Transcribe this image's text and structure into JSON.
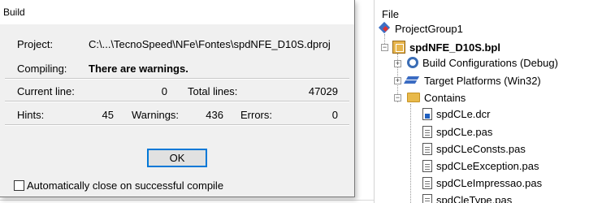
{
  "dialog": {
    "title": "Build",
    "project_label": "Project:",
    "project_value": "C:\\...\\TecnoSpeed\\NFe\\Fontes\\spdNFE_D10S.dproj",
    "compiling_label": "Compiling:",
    "compiling_value": "There are warnings.",
    "current_line_label": "Current line:",
    "current_line_value": "0",
    "total_lines_label": "Total lines:",
    "total_lines_value": "47029",
    "hints_label": "Hints:",
    "hints_value": "45",
    "warnings_label": "Warnings:",
    "warnings_value": "436",
    "errors_label": "Errors:",
    "errors_value": "0",
    "ok_label": "OK",
    "auto_close_label": "Automatically close on successful compile",
    "auto_close_checked": false
  },
  "project_manager": {
    "file_label": "File",
    "group": "ProjectGroup1",
    "project": "spdNFE_D10S.bpl",
    "build_configurations": "Build Configurations (Debug)",
    "target_platforms": "Target Platforms (Win32)",
    "contains": "Contains",
    "files": [
      "spdCLe.dcr",
      "spdCLe.pas",
      "spdCLeConsts.pas",
      "spdCLeException.pas",
      "spdCLeImpressao.pas",
      "spdCleType.pas"
    ]
  }
}
